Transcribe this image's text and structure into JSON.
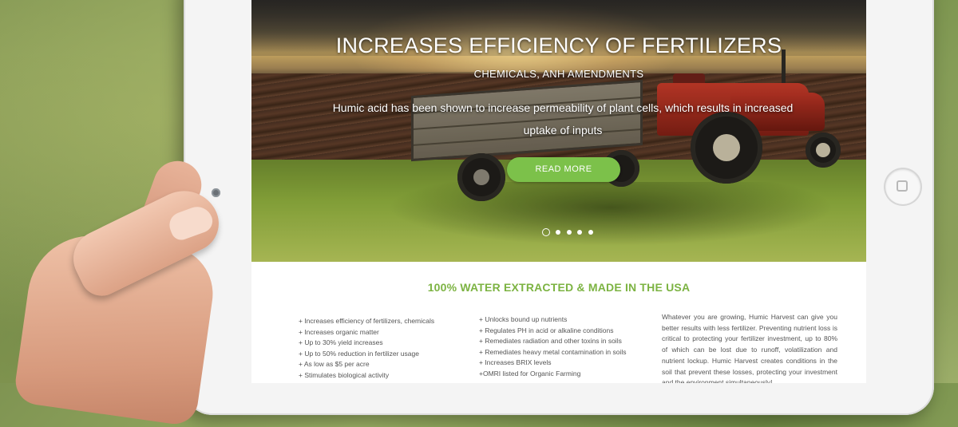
{
  "hero": {
    "title": "INCREASES EFFICIENCY OF FERTILIZERS",
    "subtitle": "CHEMICALS, ANH AMENDMENTS",
    "description": "Humic acid has been shown to increase permeability of plant cells, which results in increased uptake of inputs",
    "button_label": "READ MORE",
    "slides": {
      "count": 5,
      "active_index": 0
    }
  },
  "content": {
    "headline": "100% WATER EXTRACTED & MADE IN THE USA",
    "benefits_left": [
      "+ Increases efficiency of fertilizers, chemicals",
      "+ Increases organic matter",
      "+ Up to 30% yield increases",
      "+ Up to 50% reduction in fertilizer usage",
      "+ As low as $5 per acre",
      "+ Stimulates biological activity"
    ],
    "benefits_right": [
      "+ Unlocks bound up nutrients",
      "+ Regulates PH in acid or alkaline conditions",
      "+ Remediates radiation and other toxins in soils",
      "+ Remediates heavy metal contamination in soils",
      "+ Increases BRIX levels",
      "+OMRI listed for Organic Farming"
    ],
    "paragraph": "Whatever you are growing, Humic Harvest can give you better results with less fertilizer. Preventing nutrient loss is critical to protecting your fertilizer investment, up to 80% of which can be lost due to runoff, volatilization and nutrient lockup. Humic Harvest creates conditions in the soil that prevent these losses, protecting your investment and the environment simultaneously!"
  },
  "colors": {
    "accent_green": "#7cc14a",
    "headline_green": "#7cb342",
    "body_text": "#555555"
  }
}
